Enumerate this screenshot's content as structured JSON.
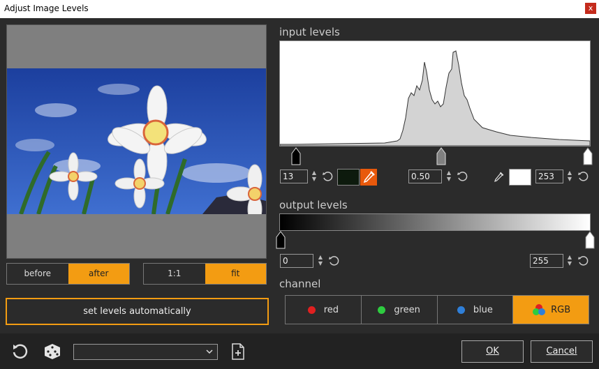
{
  "window": {
    "title": "Adjust Image Levels",
    "close_glyph": "x"
  },
  "preview_toggle": {
    "before": "before",
    "after": "after",
    "active": "after"
  },
  "zoom_toggle": {
    "one_to_one": "1:1",
    "fit": "fit",
    "active": "fit"
  },
  "auto_button": "set levels automatically",
  "input_levels": {
    "label": "input levels",
    "black_point": "13",
    "gamma": "0.50",
    "white_point": "253",
    "black_swatch_color": "#0d1a0d",
    "white_swatch_color": "#ffffff"
  },
  "output_levels": {
    "label": "output levels",
    "black_point": "0",
    "white_point": "255"
  },
  "channel": {
    "label": "channel",
    "options": [
      {
        "label": "red",
        "color": "#e02020"
      },
      {
        "label": "green",
        "color": "#2ecc40"
      },
      {
        "label": "blue",
        "color": "#2f7fd8"
      },
      {
        "label": "RGB",
        "color": ""
      }
    ],
    "active": "RGB"
  },
  "footer": {
    "preset_value": "",
    "ok": "OK",
    "cancel": "Cancel"
  },
  "colors": {
    "accent": "#f39c12",
    "background": "#2b2b2b",
    "eyedropper_active": "#e8590c"
  },
  "icons": [
    "close-icon",
    "spin-up-down-icon",
    "reset-icon",
    "eyedropper-icon",
    "reset-all-icon",
    "dice-icon",
    "chevron-down-icon",
    "new-preset-icon"
  ]
}
